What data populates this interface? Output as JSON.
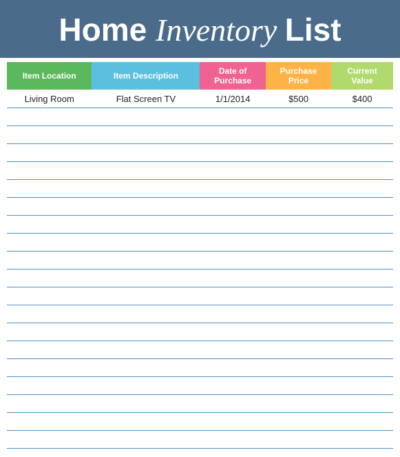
{
  "header": {
    "title_part1": "Home",
    "title_part2": "Inventory",
    "title_part3": "List"
  },
  "columns": [
    {
      "id": "location",
      "label": "Item Location",
      "color": "#5cb85c"
    },
    {
      "id": "description",
      "label": "Item Description",
      "color": "#5bc0de"
    },
    {
      "id": "date",
      "label": "Date of\nPurchase",
      "color": "#f06292"
    },
    {
      "id": "purchase_price",
      "label": "Purchase\nPrice",
      "color": "#ffb347"
    },
    {
      "id": "current_value",
      "label": "Current\nValue",
      "color": "#b0d96e"
    }
  ],
  "rows": [
    {
      "location": "Living Room",
      "description": "Flat Screen TV",
      "date": "1/1/2014",
      "purchase_price": "$500",
      "current_value": "$400"
    },
    {
      "location": "",
      "description": "",
      "date": "",
      "purchase_price": "",
      "current_value": ""
    },
    {
      "location": "",
      "description": "",
      "date": "",
      "purchase_price": "",
      "current_value": ""
    },
    {
      "location": "",
      "description": "",
      "date": "",
      "purchase_price": "",
      "current_value": ""
    },
    {
      "location": "",
      "description": "",
      "date": "",
      "purchase_price": "",
      "current_value": ""
    },
    {
      "location": "",
      "description": "",
      "date": "",
      "purchase_price": "",
      "current_value": ""
    },
    {
      "location": "",
      "description": "",
      "date": "",
      "purchase_price": "",
      "current_value": ""
    },
    {
      "location": "",
      "description": "",
      "date": "",
      "purchase_price": "",
      "current_value": ""
    },
    {
      "location": "",
      "description": "",
      "date": "",
      "purchase_price": "",
      "current_value": ""
    },
    {
      "location": "",
      "description": "",
      "date": "",
      "purchase_price": "",
      "current_value": ""
    },
    {
      "location": "",
      "description": "",
      "date": "",
      "purchase_price": "",
      "current_value": ""
    },
    {
      "location": "",
      "description": "",
      "date": "",
      "purchase_price": "",
      "current_value": ""
    },
    {
      "location": "",
      "description": "",
      "date": "",
      "purchase_price": "",
      "current_value": ""
    },
    {
      "location": "",
      "description": "",
      "date": "",
      "purchase_price": "",
      "current_value": ""
    },
    {
      "location": "",
      "description": "",
      "date": "",
      "purchase_price": "",
      "current_value": ""
    },
    {
      "location": "",
      "description": "",
      "date": "",
      "purchase_price": "",
      "current_value": ""
    },
    {
      "location": "",
      "description": "",
      "date": "",
      "purchase_price": "",
      "current_value": ""
    },
    {
      "location": "",
      "description": "",
      "date": "",
      "purchase_price": "",
      "current_value": ""
    },
    {
      "location": "",
      "description": "",
      "date": "",
      "purchase_price": "",
      "current_value": ""
    },
    {
      "location": "",
      "description": "",
      "date": "",
      "purchase_price": "",
      "current_value": ""
    }
  ]
}
